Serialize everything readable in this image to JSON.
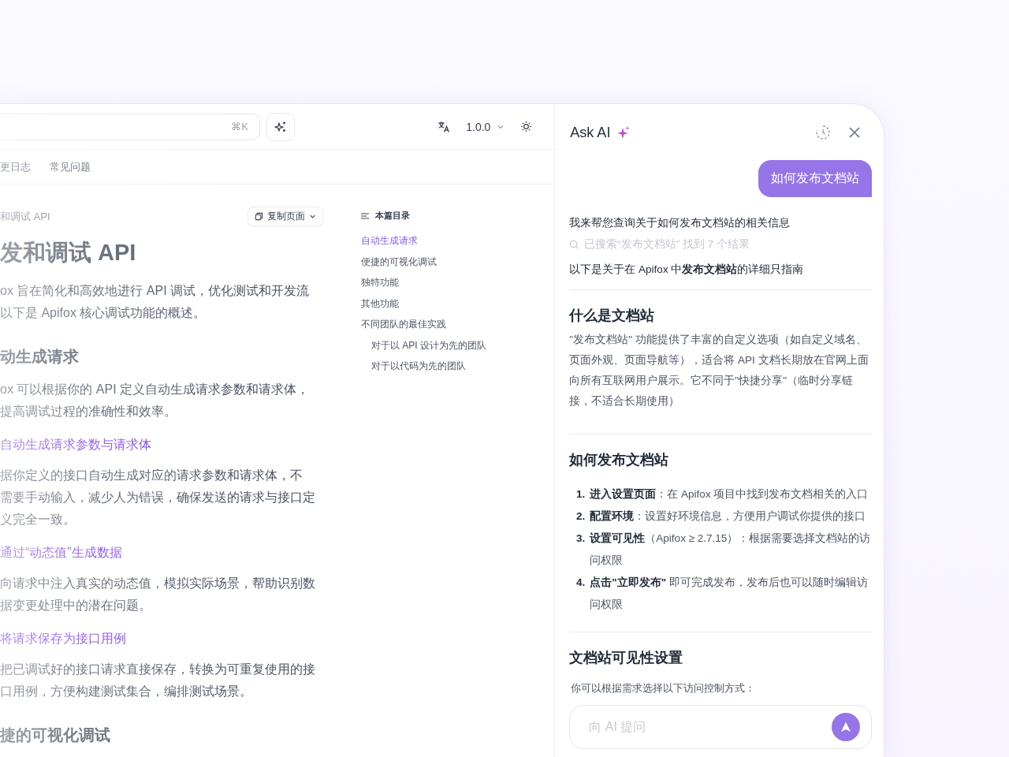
{
  "top_bar": {
    "search_shortcut": "⌘K",
    "version": "1.0.0"
  },
  "nav_tabs": [
    {
      "label": "更日志"
    },
    {
      "label": "常见问题"
    }
  ],
  "doc": {
    "breadcrumb": "和调试 API",
    "copy_button": "复制页面",
    "title": "发和调试 API",
    "blocks": [
      {
        "kind": "paragraph",
        "lines": [
          "ox 旨在简化和高效地进行 API 调试，优化测试和开发流",
          "以下是 Apifox 核心调试功能的概述。"
        ]
      },
      {
        "kind": "heading",
        "text": "动生成请求"
      },
      {
        "kind": "paragraph",
        "lines": [
          "ox 可以根据你的 API 定义自动生成请求参数和请求体，",
          "提高调试过程的准确性和效率。"
        ]
      },
      {
        "kind": "subheading",
        "text": "自动生成请求参数与请求体"
      },
      {
        "kind": "paragraph",
        "lines": [
          "据你定义的接口自动生成对应的请求参数和请求体，不",
          "需要手动输入，减少人为错误，确保发送的请求与接口定",
          "义完全一致。"
        ]
      },
      {
        "kind": "subheading",
        "text": "通过“动态值”生成数据"
      },
      {
        "kind": "paragraph",
        "lines": [
          "向请求中注入真实的动态值，模拟实际场景，帮助识别数",
          "据变更处理中的潜在问题。"
        ]
      },
      {
        "kind": "subheading",
        "text": "将请求保存为接口用例"
      },
      {
        "kind": "paragraph",
        "lines": [
          "把已调试好的接口请求直接保存，转换为可重复使用的接",
          "口用例，方便构建测试集合，编排测试场景。"
        ]
      },
      {
        "kind": "heading",
        "text": "捷的可视化调试"
      }
    ]
  },
  "toc": {
    "title": "本篇目录",
    "items": [
      {
        "label": "自动生成请求",
        "selected": true
      },
      {
        "label": "便捷的可视化调试",
        "selected": false
      },
      {
        "label": "独特功能",
        "selected": false
      },
      {
        "label": "其他功能",
        "selected": false
      },
      {
        "label": "不同团队的最佳实践",
        "selected": false,
        "children": [
          {
            "label": "对于以 API 设计为先的团队",
            "selected": false
          },
          {
            "label": "对于以代码为先的团队",
            "selected": false
          }
        ]
      }
    ]
  },
  "ai_panel": {
    "title": "Ask AI",
    "question": "如何发布文档站",
    "blocks": [
      {
        "kind": "text",
        "text": "我来帮您查询关于如何发布文档站的相关信息"
      },
      {
        "kind": "search_status",
        "text": "已搜索“发布文档站” 找到 7 个结果"
      },
      {
        "kind": "text",
        "text": "以下是关于在 Apifox 中**发布文档站**的详细只指南"
      },
      {
        "kind": "divider"
      },
      {
        "kind": "heading",
        "text": "什么是文档站"
      },
      {
        "kind": "paragraph",
        "text": "\"发布文档站\" 功能提供了丰富的自定义选项（如自定义域名、页面外观、页面导航等），适合将 API 文档长期放在官网上面向所有互联网用户展示。它不同于\"快捷分享\"（临时分享链接，不适合长期使用）"
      },
      {
        "kind": "divider"
      },
      {
        "kind": "heading",
        "text": "如何发布文档站"
      },
      {
        "kind": "list",
        "items": [
          {
            "number": "1.",
            "text": "**进入设置页面**：在 Apifox 项目中找到发布文档相关的入口"
          },
          {
            "number": "2.",
            "text": "**配置环境**：设置好环境信息，方便用户调试你提供的接口"
          },
          {
            "number": "3.",
            "text": "**设置可见性**（Apifox ≥ 2.7.15）：根据需要选择文档站的访问权限"
          },
          {
            "number": "4.",
            "text": "**点击\"立即发布\"** 即可完成发布，发布后也可以随时编辑访问权限"
          }
        ]
      },
      {
        "kind": "divider"
      },
      {
        "kind": "heading",
        "text": "文档站可见性设置"
      },
      {
        "kind": "note",
        "text": "你可以根据需求选择以下访问控制方式："
      }
    ],
    "input": {
      "placeholder": "向 AI 提问"
    }
  }
}
